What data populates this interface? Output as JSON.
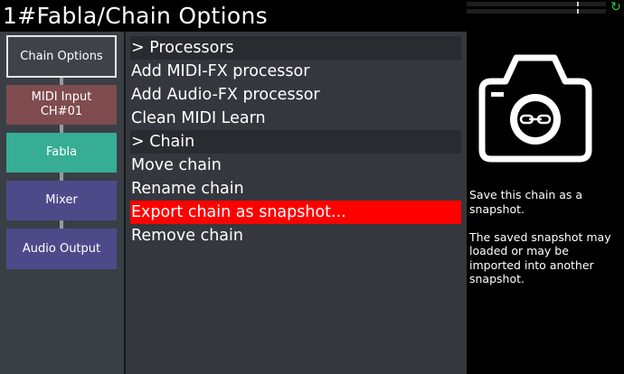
{
  "header": {
    "title": "1#Fabla/Chain Options"
  },
  "icons": {
    "refresh": "refresh-icon",
    "camera": "camera-icon"
  },
  "sidebar": {
    "nodes": [
      {
        "line1": "Chain Options",
        "line2": "",
        "color": "#3f4349",
        "selected": true
      },
      {
        "line1": "MIDI Input",
        "line2": "CH#01",
        "color": "#7f4c4f"
      },
      {
        "line1": "Fabla",
        "line2": "",
        "color": "#36ad94"
      },
      {
        "line1": "Mixer",
        "line2": "",
        "color": "#4e4a8a"
      },
      {
        "line1": "Audio Output",
        "line2": "",
        "color": "#4e4a8a"
      }
    ]
  },
  "menu": {
    "items": [
      {
        "label": "> Processors",
        "type": "header"
      },
      {
        "label": "Add MIDI-FX processor",
        "type": "item"
      },
      {
        "label": "Add Audio-FX processor",
        "type": "item"
      },
      {
        "label": "Clean MIDI Learn",
        "type": "item"
      },
      {
        "label": "> Chain",
        "type": "header"
      },
      {
        "label": "Move chain",
        "type": "item"
      },
      {
        "label": "Rename chain",
        "type": "item"
      },
      {
        "label": "Export chain as snapshot...",
        "type": "item",
        "selected": true
      },
      {
        "label": "Remove chain",
        "type": "item"
      }
    ],
    "selected_color": "#ff0000"
  },
  "info": {
    "para1": "Save this chain as a snapshot.",
    "para2": "The saved snapshot may loaded or may be imported into another snapshot."
  }
}
